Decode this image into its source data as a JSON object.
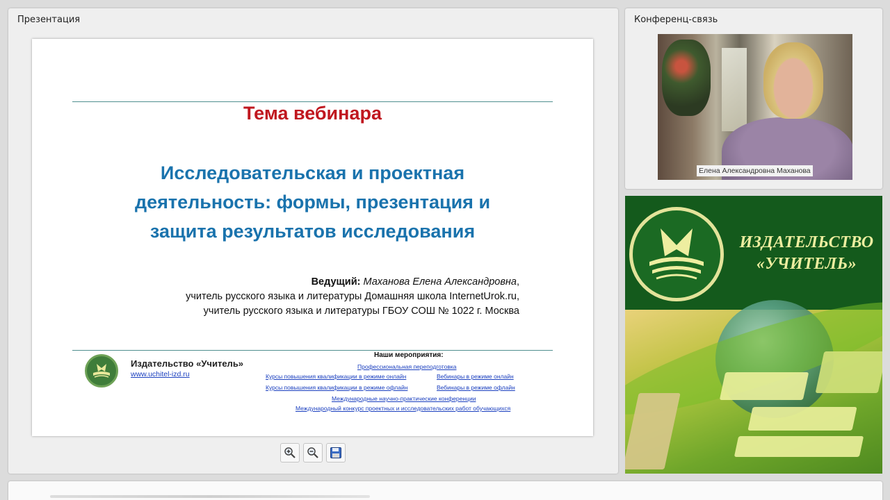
{
  "presentation": {
    "panel_title": "Презентация",
    "slide": {
      "theme_title": "Тема вебинара",
      "topic_lines": [
        "Исследовательская и проектная",
        "деятельность: формы, презентация и",
        "защита результатов исследования"
      ],
      "host_label": "Ведущий:",
      "host_name": "Маханова Елена Александровна",
      "host_name_suffix": ",",
      "host_line2": "учитель русского языка и литературы Домашняя школа InternetUrok.ru,",
      "host_line3": "учитель русского языка и литературы ГБОУ СОШ № 1022 г. Москва",
      "publisher_name": "Издательство «Учитель»",
      "publisher_url": "www.uchitel-izd.ru",
      "events_title": "Наши мероприятия:",
      "events": [
        "Профессиональная переподготовка",
        "Курсы повышения квалификации в режиме онлайн",
        "Вебинары в режиме онлайн",
        "Курсы повышения квалификации в режиме офлайн",
        "Вебинары в режиме офлайн",
        "Международные научно-практические конференции",
        "Международный конкурс проектных и исследовательских работ обучающихся"
      ]
    },
    "toolbar": {
      "zoom_in_icon": "zoom-in-icon",
      "zoom_out_icon": "zoom-out-icon",
      "save_icon": "floppy-disk-icon"
    }
  },
  "conference": {
    "panel_title": "Конференц-связь",
    "participant_name": "Елена Александровна Маханова"
  },
  "ad": {
    "line1": "ИЗДАТЕЛЬСТВО",
    "line2": "«УЧИТЕЛЬ»"
  },
  "colors": {
    "theme_red": "#c0171f",
    "topic_blue": "#1a73ad",
    "brand_green": "#145a1c",
    "brand_yellow": "#eeeea0",
    "link_blue": "#1a3fbf"
  }
}
